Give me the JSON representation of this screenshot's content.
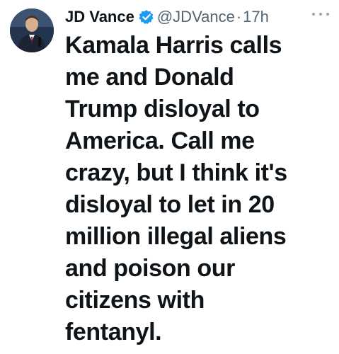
{
  "tweet": {
    "author_name": "JD Vance",
    "handle": "@JDVance",
    "separator": "·",
    "time": "17h",
    "avatar_icon": "profile-photo-icon",
    "verified_icon": "verified-badge-icon",
    "more_icon": "more-options-icon",
    "text": "Kamala Harris calls\nme and Donald\nTrump disloyal to\nAmerica. Call me\ncrazy, but I think it's\ndisloyal to let in 20\nmillion illegal aliens\nand poison our\ncitizens with\nfentanyl."
  },
  "colors": {
    "text_primary": "#0f1419",
    "text_secondary": "#536471",
    "verified_blue": "#1d9bf0"
  }
}
